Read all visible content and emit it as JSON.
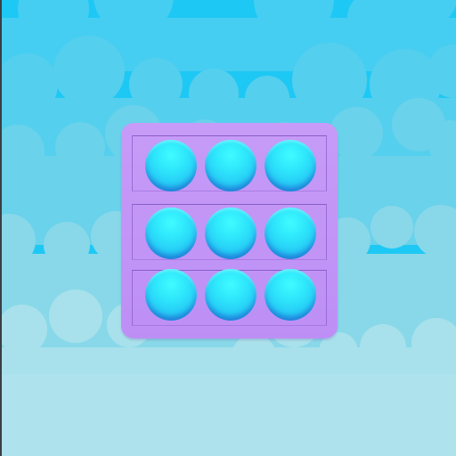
{
  "game": {
    "type": "pop-it fidget",
    "colors": {
      "sky_top": "#1ec8f4",
      "cloud_far": "#55d0ee",
      "cloud_mid": "#7fd3e8",
      "cloud_near": "#aee2ec",
      "board": "#c49af6",
      "bubble": "#2ee4fb",
      "left_edge": "#3a3f45"
    },
    "board": {
      "rows": 3,
      "cols": 3,
      "bubbles": [
        {
          "row": 1,
          "col": 1,
          "state": "unpopped"
        },
        {
          "row": 1,
          "col": 2,
          "state": "unpopped"
        },
        {
          "row": 1,
          "col": 3,
          "state": "unpopped"
        },
        {
          "row": 2,
          "col": 1,
          "state": "unpopped"
        },
        {
          "row": 2,
          "col": 2,
          "state": "unpopped"
        },
        {
          "row": 2,
          "col": 3,
          "state": "unpopped"
        },
        {
          "row": 3,
          "col": 1,
          "state": "unpopped"
        },
        {
          "row": 3,
          "col": 2,
          "state": "unpopped"
        },
        {
          "row": 3,
          "col": 3,
          "state": "unpopped"
        }
      ]
    }
  }
}
